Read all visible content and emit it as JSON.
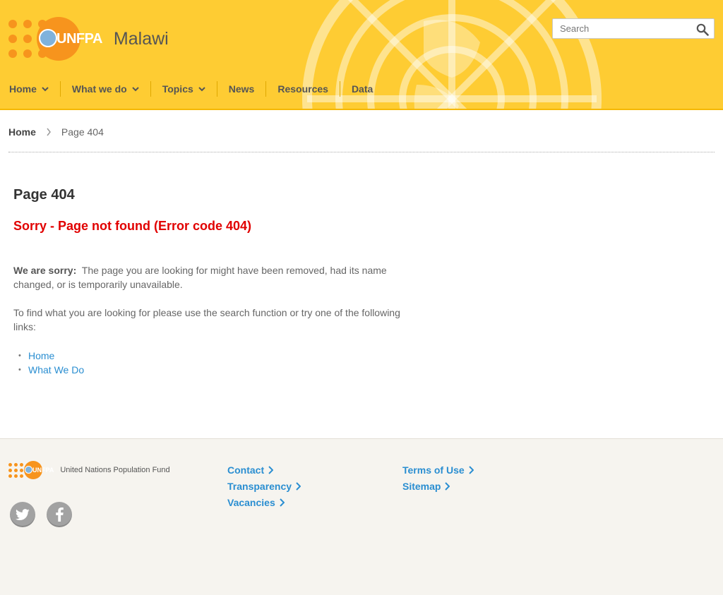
{
  "header": {
    "brand": "UNFPA",
    "country": "Malawi",
    "search_placeholder": "Search",
    "nav": [
      {
        "label": "Home",
        "dropdown": true
      },
      {
        "label": "What we do",
        "dropdown": true
      },
      {
        "label": "Topics",
        "dropdown": true
      },
      {
        "label": "News",
        "dropdown": false
      },
      {
        "label": "Resources",
        "dropdown": false
      },
      {
        "label": "Data",
        "dropdown": false
      }
    ]
  },
  "breadcrumb": {
    "home": "Home",
    "current": "Page 404"
  },
  "content": {
    "title": "Page 404",
    "error": "Sorry - Page not found (Error code 404)",
    "sorry_label": "We are sorry:",
    "sorry_text": "The page you are looking for might have been removed, had its name changed, or is temporarily unavailable.",
    "find_text": "To find what you are looking for please use the search function or try one of the following links:",
    "links": [
      "Home",
      "What We Do"
    ]
  },
  "footer": {
    "brand": "UNFPA",
    "org_name": "United Nations Population Fund",
    "col1": [
      "Contact",
      "Transparency",
      "Vacancies"
    ],
    "col2": [
      "Terms of Use",
      "Sitemap"
    ],
    "social": [
      "twitter-icon",
      "facebook-icon"
    ]
  },
  "colors": {
    "header_bg": "#fecc33",
    "accent_orange": "#f7941d",
    "error_red": "#e10000",
    "link_blue": "#2a8ed1",
    "footer_bg": "#f6f4ef"
  }
}
